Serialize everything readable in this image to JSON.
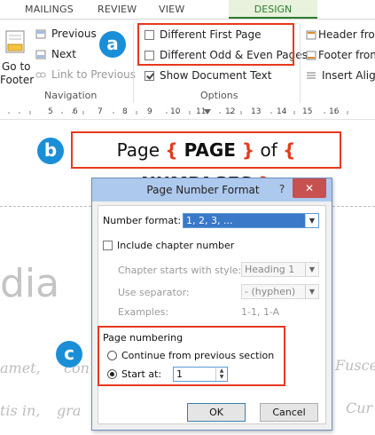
{
  "tabs": {
    "mailings": "MAILINGS",
    "review": "REVIEW",
    "view": "VIEW",
    "design": "DESIGN"
  },
  "nav": {
    "goto_footer": "Go to\nFooter",
    "goto_footer_l1": "Go to",
    "goto_footer_l2": "Footer",
    "previous": "Previous",
    "next": "Next",
    "link_previous": "Link to Previous",
    "group_label": "Navigation"
  },
  "options": {
    "different_first_page": "Different First Page",
    "different_odd_even": "Different Odd & Even Pages",
    "show_document_text": "Show Document Text",
    "group_label": "Options"
  },
  "position": {
    "header_from": "Header fron",
    "footer_from": "Footer fron",
    "insert_align": "Insert Align"
  },
  "badges": {
    "a": "a",
    "b": "b",
    "c": "c"
  },
  "ruler": [
    "5",
    "6",
    "7",
    "8",
    "9",
    "10",
    "11",
    "12",
    "13",
    "14",
    "15",
    "16"
  ],
  "field_code": {
    "prefix": "Page ",
    "open1": "{ ",
    "field1": "PAGE",
    "close1": " }",
    "middle": " of ",
    "open2": "{ ",
    "field2": "NUMPAGES",
    "close2": "  }"
  },
  "background": {
    "heading": "dia",
    "line1_a": "amet,",
    "line1_b": "con",
    "line1_c": "Fusce",
    "line2_a": "tis in,",
    "line2_b": "gra",
    "line2_c": "Cur"
  },
  "dialog": {
    "title": "Page Number Format",
    "help": "?",
    "close": "✕",
    "number_format_label": "Number format:",
    "number_format_value": "1, 2, 3, ...",
    "include_chapter": "Include chapter number",
    "chapter_style_label": "Chapter starts with style:",
    "chapter_style_value": "Heading 1",
    "separator_label": "Use separator:",
    "separator_value": "-   (hyphen)",
    "examples_label": "Examples:",
    "examples_value": "1-1, 1-A",
    "page_numbering_label": "Page numbering",
    "continue_label": "Continue from previous section",
    "start_at_label": "Start at:",
    "start_at_value": "1",
    "ok": "OK",
    "cancel": "Cancel"
  },
  "colors": {
    "accent_red": "#e8391c",
    "badge_blue": "#1a8fd8",
    "design_green": "#2e7d32",
    "title_bar": "#aec9ee"
  }
}
